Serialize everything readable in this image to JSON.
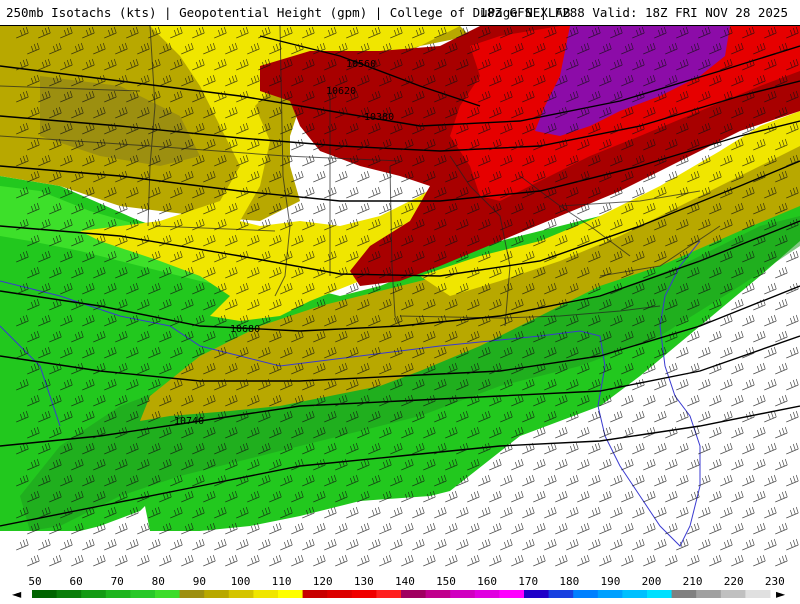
{
  "header": {
    "left_title": "250mb Isotachs (kts) | Geopotential Height (gpm) | College of DuPage NEXLAB",
    "right_title": "18Z GFS | F288 Valid: 18Z FRI NOV 28 2025"
  },
  "colors": {
    "white_zone": "#ffffff",
    "green_dark": "#1f9a1f",
    "green": "#22c81e",
    "green_bright": "#3de02a",
    "olive": "#b8a800",
    "olive_dark": "#9c8f10",
    "yellow": "#f0e600",
    "dark_red": "#a80000",
    "red": "#e60000",
    "purple": "#8c0ca8",
    "state_lines": "#222222",
    "coast_lines": "#3a3ad0",
    "height_contours": "#000000"
  },
  "height_contour_labels": [
    "10560",
    "10620",
    "10380",
    "10680",
    "10740"
  ],
  "legend": {
    "ticks": [
      "50",
      "60",
      "70",
      "80",
      "90",
      "100",
      "110",
      "120",
      "130",
      "140",
      "150",
      "160",
      "170",
      "180",
      "190",
      "200",
      "210",
      "220",
      "230"
    ],
    "swatches": [
      "#006400",
      "#0a7d0a",
      "#149a14",
      "#1eb41e",
      "#28c828",
      "#3cdc2a",
      "#9c8f10",
      "#b8a800",
      "#d4c400",
      "#f0e600",
      "#ffff00",
      "#c80000",
      "#dc0000",
      "#f00000",
      "#ff2020",
      "#a00060",
      "#c0008c",
      "#d000c0",
      "#e000e0",
      "#ff00ff",
      "#2000c8",
      "#1840e0",
      "#0080ff",
      "#00a0ff",
      "#00c0ff",
      "#00e0ff",
      "#808080",
      "#a0a0a0",
      "#c0c0c0",
      "#e0e0e0"
    ],
    "left_arrow": "◄",
    "right_arrow": "►"
  }
}
